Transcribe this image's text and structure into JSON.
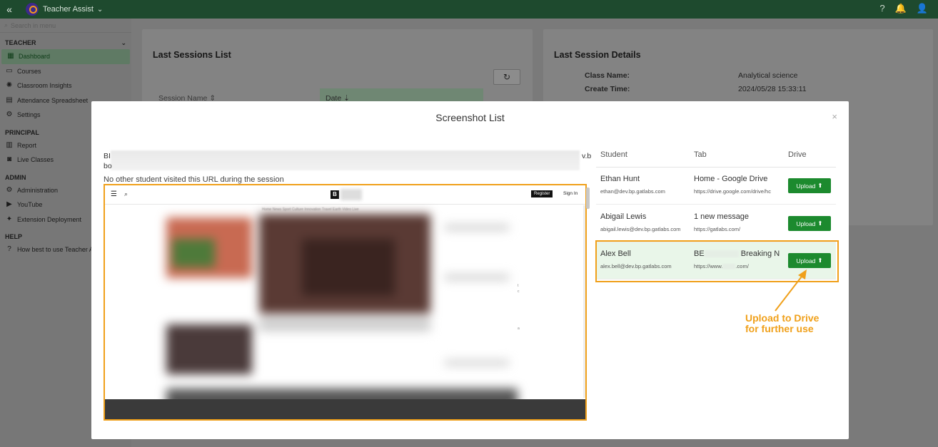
{
  "topbar": {
    "collapse": "«",
    "app_name": "Teacher Assist",
    "caret": "⌄",
    "help_icon": "?",
    "bell_icon": "🔔",
    "user_icon": "👤"
  },
  "sidebar": {
    "search_placeholder": "Search in menu",
    "sections": [
      {
        "label": "TEACHER",
        "items": [
          {
            "label": "Dashboard",
            "icon": "dashboard-icon",
            "glyph": "▦",
            "active": true
          },
          {
            "label": "Courses",
            "icon": "courses-icon",
            "glyph": "▭"
          },
          {
            "label": "Classroom Insights",
            "icon": "bulb-icon",
            "glyph": "✺"
          },
          {
            "label": "Attendance Spreadsheet",
            "icon": "spreadsheet-icon",
            "glyph": "▤"
          },
          {
            "label": "Settings",
            "icon": "gear-icon",
            "glyph": "⚙"
          }
        ]
      },
      {
        "label": "PRINCIPAL",
        "items": [
          {
            "label": "Report",
            "icon": "report-icon",
            "glyph": "▥"
          },
          {
            "label": "Live Classes",
            "icon": "live-classes-icon",
            "glyph": "◙"
          }
        ]
      },
      {
        "label": "ADMIN",
        "items": [
          {
            "label": "Administration",
            "icon": "gear-icon",
            "glyph": "⚙"
          },
          {
            "label": "YouTube",
            "icon": "youtube-icon",
            "glyph": "▶"
          },
          {
            "label": "Extension Deployment",
            "icon": "puzzle-icon",
            "glyph": "✦"
          }
        ]
      },
      {
        "label": "HELP",
        "items": [
          {
            "label": "How best to use Teacher Assist",
            "icon": "question-icon",
            "glyph": "?"
          }
        ]
      }
    ]
  },
  "background": {
    "sessions_title": "Last Sessions List",
    "session_name_header": "Session Name ⇕",
    "date_header": "Date ⇣",
    "details_title": "Last Session Details",
    "class_name_label": "Class Name:",
    "class_name_value": "Analytical science",
    "create_time_label": "Create Time:",
    "create_time_value": "2024/05/28 15:33:11"
  },
  "modal": {
    "title": "Screenshot List",
    "close": "×",
    "url_line1": "BI",
    "url_line2": "bo",
    "url_tail": "v.b",
    "note": "No other student visited this URL during the session",
    "shot": {
      "brand": "B",
      "register": "Register",
      "sign_in": "Sign In",
      "nav_links": "Home  News  Sport  Culture  Innovation  Travel  Earth  Video  Live"
    },
    "table": {
      "headers": [
        "Student",
        "Tab",
        "Drive"
      ],
      "rows": [
        {
          "name": "Ethan Hunt",
          "email": "ethan@dev.bp.gatlabs.com",
          "tab": "Home - Google Drive",
          "url": "https://drive.google.com/drive/hc",
          "upload": "Upload"
        },
        {
          "name": "Abigail Lewis",
          "email": "abigail.lewis@dev.bp.gatlabs.com",
          "tab": "1 new message",
          "url": "https://gatlabs.com/",
          "upload": "Upload"
        },
        {
          "name": "Alex Bell",
          "email": "alex.bell@dev.bp.gatlabs.com",
          "tab_prefix": "BE",
          "tab_suffix": "Breaking N",
          "url_prefix": "https://www.",
          "url_suffix": ".com/",
          "upload": "Upload"
        }
      ]
    }
  },
  "annotation": {
    "line1": "Upload to Drive",
    "line2": "for further use",
    "color": "#f0a01a"
  }
}
